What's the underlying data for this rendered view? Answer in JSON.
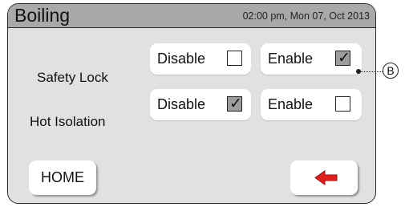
{
  "header": {
    "title": "Boiling",
    "datetime": "02:00 pm, Mon 07, Oct 2013"
  },
  "rows": [
    {
      "label": "Safety Lock",
      "options": [
        {
          "label": "Disable",
          "checked": false
        },
        {
          "label": "Enable",
          "checked": true
        }
      ]
    },
    {
      "label": "Hot Isolation",
      "options": [
        {
          "label": "Disable",
          "checked": true
        },
        {
          "label": "Enable",
          "checked": false
        }
      ]
    }
  ],
  "buttons": {
    "home_label": "HOME",
    "back_icon": "left-arrow-icon"
  },
  "callout": {
    "letter": "B"
  },
  "colors": {
    "panel_bg": "#e1e1e1",
    "titlebar_bg": "#a9a9a9",
    "checked_bg": "#9d9d9d",
    "arrow_red": "#e01e1e"
  }
}
